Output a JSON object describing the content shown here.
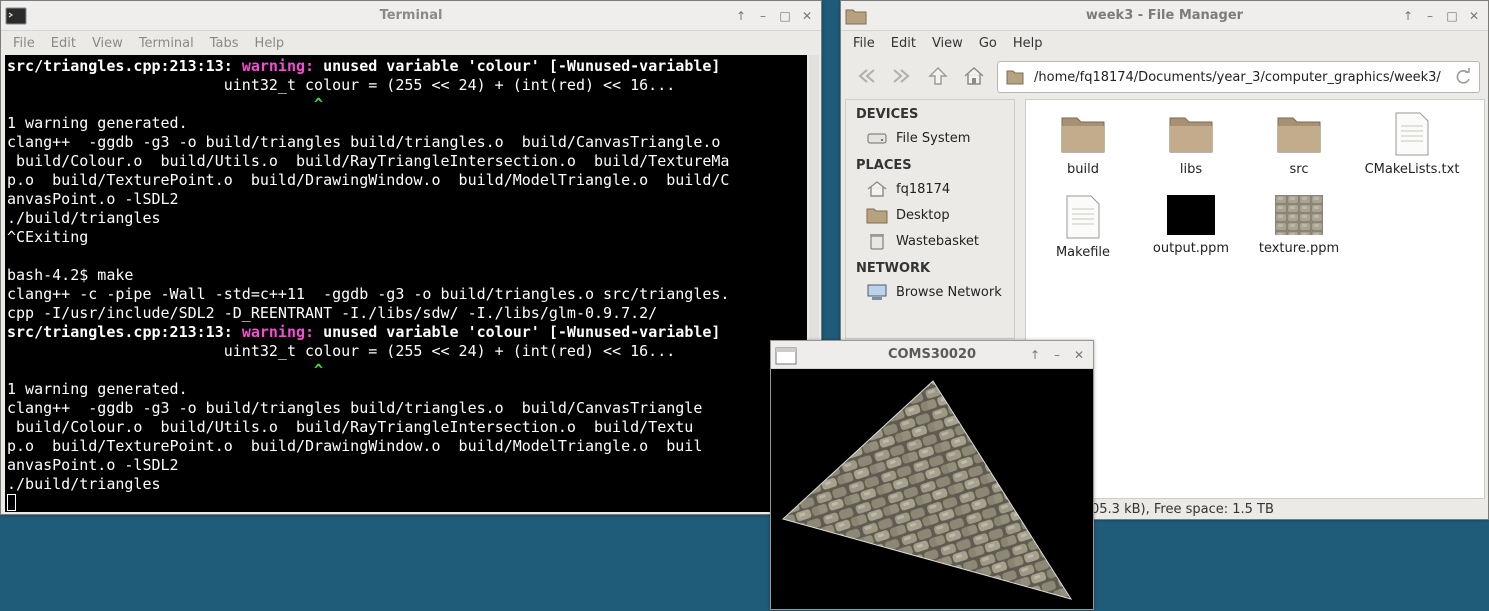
{
  "terminal": {
    "title": "Terminal",
    "menu": [
      "File",
      "Edit",
      "View",
      "Terminal",
      "Tabs",
      "Help"
    ],
    "controls": {
      "up": "↑",
      "minimize": "–",
      "maximize": "□",
      "close": "✕"
    },
    "lines": [
      {
        "file": "src/triangles.cpp:213:13: ",
        "warn": "warning:",
        "msg": " unused variable 'colour' [-Wunused-variable]"
      },
      {
        "text": "                        uint32_t colour = (255 << 24) + (int(red) << 16..."
      },
      {
        "caret": "                                  ^"
      },
      {
        "text": "1 warning generated."
      },
      {
        "text": "clang++  -ggdb -g3 -o build/triangles build/triangles.o  build/CanvasTriangle.o"
      },
      {
        "text": " build/Colour.o  build/Utils.o  build/RayTriangleIntersection.o  build/TextureMa"
      },
      {
        "text": "p.o  build/TexturePoint.o  build/DrawingWindow.o  build/ModelTriangle.o  build/C"
      },
      {
        "text": "anvasPoint.o -lSDL2"
      },
      {
        "text": "./build/triangles"
      },
      {
        "text": "^CExiting"
      },
      {
        "text": ""
      },
      {
        "text": "bash-4.2$ make"
      },
      {
        "text": "clang++ -c -pipe -Wall -std=c++11  -ggdb -g3 -o build/triangles.o src/triangles."
      },
      {
        "text": "cpp -I/usr/include/SDL2 -D_REENTRANT -I./libs/sdw/ -I./libs/glm-0.9.7.2/"
      },
      {
        "file": "src/triangles.cpp:213:13: ",
        "warn": "warning:",
        "msg": " unused variable 'colour' [-Wunused-variable]"
      },
      {
        "text": "                        uint32_t colour = (255 << 24) + (int(red) << 16..."
      },
      {
        "caret": "                                  ^"
      },
      {
        "text": "1 warning generated."
      },
      {
        "text": "clang++  -ggdb -g3 -o build/triangles build/triangles.o  build/CanvasTriangle"
      },
      {
        "text": " build/Colour.o  build/Utils.o  build/RayTriangleIntersection.o  build/Textu"
      },
      {
        "text": "p.o  build/TexturePoint.o  build/DrawingWindow.o  build/ModelTriangle.o  buil"
      },
      {
        "text": "anvasPoint.o -lSDL2"
      },
      {
        "text": "./build/triangles"
      }
    ],
    "colors": {
      "bg": "#000000",
      "fg": "#ffffff",
      "warning": "#f050d0",
      "caret": "#38e038"
    }
  },
  "filemanager": {
    "title": "week3 - File Manager",
    "menu": [
      "File",
      "Edit",
      "View",
      "Go",
      "Help"
    ],
    "controls": {
      "up": "↑",
      "minimize": "–",
      "maximize": "□",
      "close": "✕"
    },
    "path": "/home/fq18174/Documents/year_3/computer_graphics/week3/",
    "sidebar": {
      "devices_heading": "DEVICES",
      "file_system": "File System",
      "places_heading": "PLACES",
      "home": "fq18174",
      "desktop": "Desktop",
      "wastebasket": "Wastebasket",
      "network_heading": "NETWORK",
      "browse_network": "Browse Network"
    },
    "files": [
      {
        "name": "build",
        "icon": "folder-icon"
      },
      {
        "name": "libs",
        "icon": "folder-icon"
      },
      {
        "name": "src",
        "icon": "folder-icon"
      },
      {
        "name": "CMakeLists.txt",
        "icon": "text-file-icon"
      },
      {
        "name": "Makefile",
        "icon": "text-file-icon"
      },
      {
        "name": "output.ppm",
        "icon": "black-image-thumbnail"
      },
      {
        "name": "texture.ppm",
        "icon": "stone-texture-thumbnail"
      }
    ],
    "status": "05.3 kB), Free space: 1.5 TB"
  },
  "sdl_window": {
    "title": "COMS30020",
    "controls": {
      "up": "↑",
      "minimize": "–",
      "close": "✕"
    }
  }
}
